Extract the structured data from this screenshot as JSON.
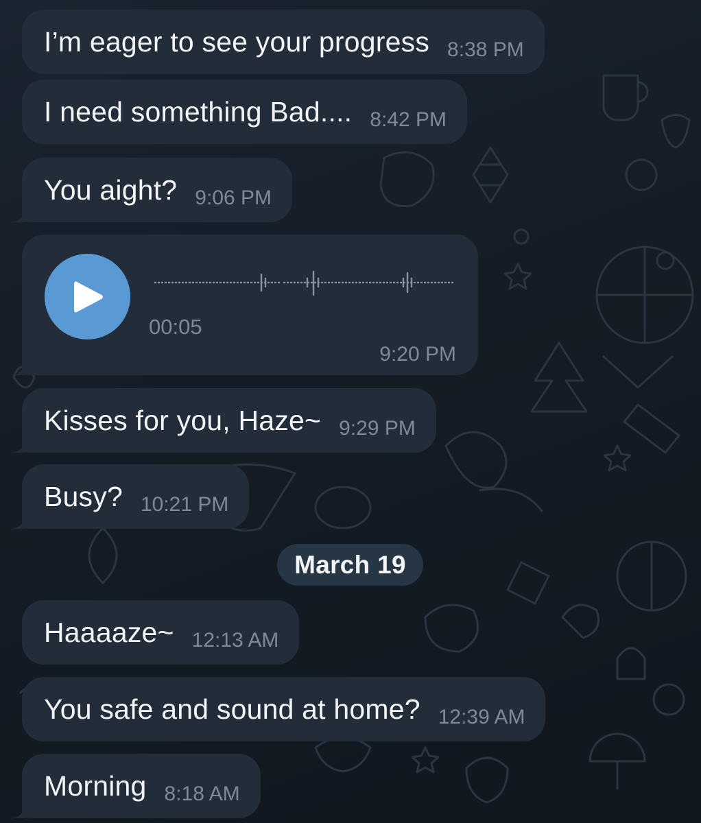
{
  "colors": {
    "background": "#141c25",
    "bubble": "#222d39",
    "text": "#f2f4f6",
    "time": "#7c8a99",
    "play_button": "#5a9ad4",
    "date_pill": "#273645"
  },
  "messages_top": [
    {
      "text": "I’m eager to see your progress",
      "time": "8:38 PM"
    },
    {
      "text": "I need something Bad....",
      "time": "8:42 PM"
    },
    {
      "text": "You aight?",
      "time": "9:06 PM"
    }
  ],
  "voice_message": {
    "icon": "play-icon",
    "duration": "00:05",
    "time": "9:20 PM"
  },
  "messages_mid": [
    {
      "text": "Kisses for you, Haze~",
      "time": "9:29 PM"
    },
    {
      "text": "Busy?",
      "time": "10:21 PM"
    }
  ],
  "date_separator": "March 19",
  "messages_bottom": [
    {
      "text": "Haaaaze~",
      "time": "12:13 AM"
    },
    {
      "text": "You safe and sound at home?",
      "time": "12:39 AM"
    },
    {
      "text": "Morning",
      "time": "8:18 AM"
    }
  ]
}
